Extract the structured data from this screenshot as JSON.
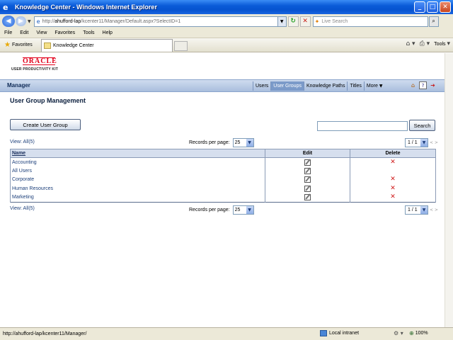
{
  "window": {
    "title": "Knowledge Center - Windows Internet Explorer"
  },
  "address_bar": {
    "url_prefix": "http://",
    "url_host": "ahufford-lap",
    "url_rest": "/kcenter11/Manager/Default.aspx?SelectID=1"
  },
  "live_search": {
    "placeholder": "Live Search"
  },
  "menu": [
    "File",
    "Edit",
    "View",
    "Favorites",
    "Tools",
    "Help"
  ],
  "favorites_bar": {
    "favorites_label": "Favorites",
    "tab_title": "Knowledge Center",
    "tools_label": "Tools"
  },
  "logo": {
    "brand": "ORACLE",
    "product": "USER PRODUCTIVITY KIT"
  },
  "navbar": {
    "section": "Manager",
    "links": [
      "Users",
      "User Groups",
      "Knowledge Paths",
      "Titles",
      "More"
    ],
    "active_index": 1
  },
  "page": {
    "title": "User Group Management",
    "create_button": "Create User Group",
    "search_button": "Search",
    "search_value": "",
    "view_label": "View: All(5)",
    "records_per_page_label": "Records per page:",
    "records_per_page": "25",
    "pager": "1 / 1",
    "pager_nav": "< >"
  },
  "table": {
    "columns": [
      "Name",
      "Edit",
      "Delete"
    ],
    "rows": [
      {
        "name": "Accounting",
        "deletable": true
      },
      {
        "name": "All Users",
        "deletable": false
      },
      {
        "name": "Corporate",
        "deletable": true
      },
      {
        "name": "Human Resources",
        "deletable": true
      },
      {
        "name": "Marketing",
        "deletable": true
      }
    ]
  },
  "status_bar": {
    "text": "http://ahufford-lap/kcenter11/Manager/",
    "zone": "Local intranet",
    "zoom": "100%"
  },
  "colors": {
    "accent": "#0653d0",
    "nav_active": "#7b9ac9",
    "delete": "#d01a1a",
    "oracle_red": "#e2001a"
  }
}
